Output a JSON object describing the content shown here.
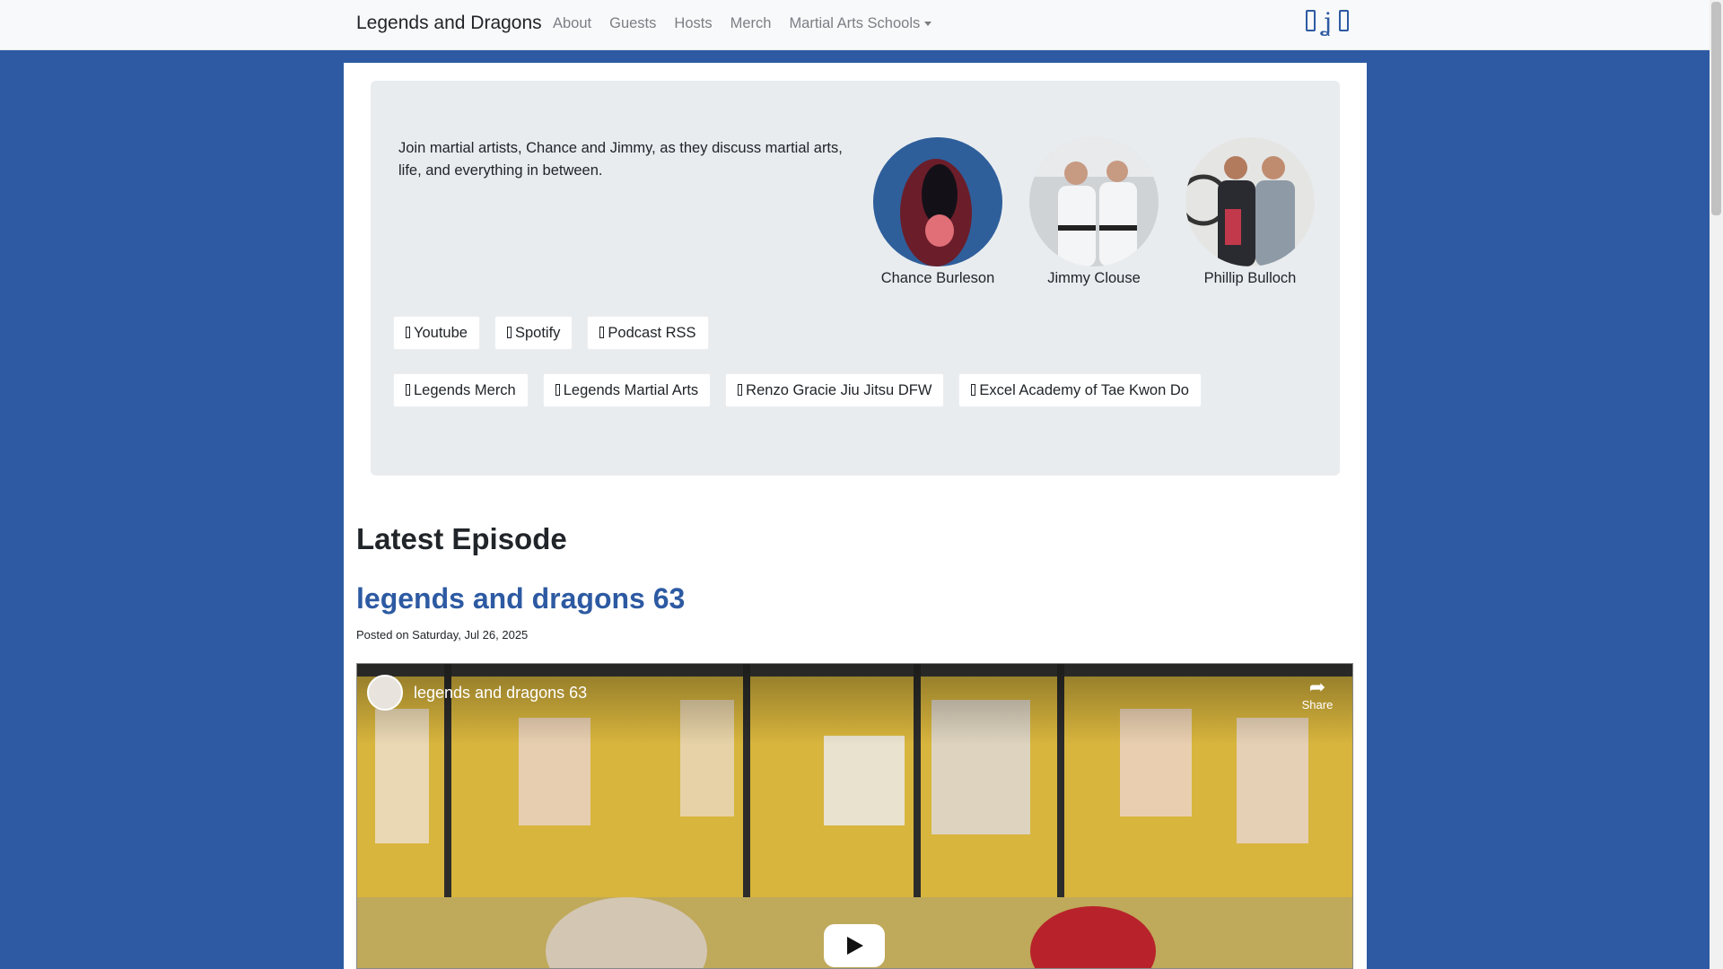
{
  "navbar": {
    "brand": "Legends and Dragons",
    "links": [
      "About",
      "Guests",
      "Hosts",
      "Merch",
      "Martial Arts Schools"
    ],
    "social_icons": [
      "facebook-icon",
      "threads-icon",
      "instagram-icon"
    ]
  },
  "intro": {
    "tagline": "Join martial artists, Chance and Jimmy, as they discuss martial arts, life, and everything in between."
  },
  "hosts": [
    {
      "name": "Chance Burleson"
    },
    {
      "name": "Jimmy Clouse"
    },
    {
      "name": "Phillip Bulloch"
    }
  ],
  "listen_buttons": [
    "Youtube",
    "Spotify",
    "Podcast RSS"
  ],
  "link_buttons": [
    "Legends Merch",
    "Legends Martial Arts",
    "Renzo Gracie Jiu Jitsu DFW",
    "Excel Academy of Tae Kwon Do"
  ],
  "latest": {
    "section_title": "Latest Episode",
    "episode_title": "legends and dragons 63",
    "posted": "Posted on Saturday, Jul 26, 2025",
    "video_title": "legends and dragons 63",
    "share_label": "Share"
  },
  "colors": {
    "accent": "#2d5aa2",
    "navbar_bg": "#f8f9fa",
    "jumbotron_bg": "#e9ecef"
  }
}
